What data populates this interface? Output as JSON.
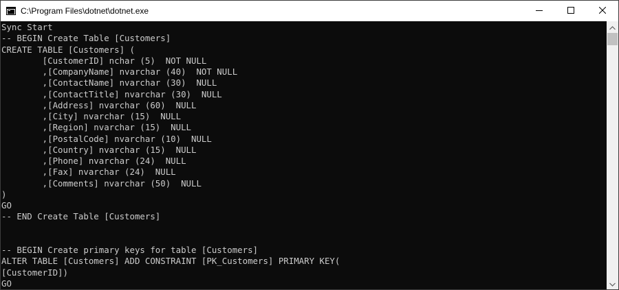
{
  "window": {
    "title": "C:\\Program Files\\dotnet\\dotnet.exe"
  },
  "icons": {
    "app": "console-app-icon",
    "minimize": "minimize-icon",
    "maximize": "maximize-icon",
    "close": "close-icon",
    "scroll_up": "chevron-up-icon",
    "scroll_down": "chevron-down-icon"
  },
  "colors": {
    "console_background": "#0c0c0c",
    "console_text": "#cccccc",
    "titlebar": "#ffffff",
    "scrollbar_track": "#f0f0f0",
    "scrollbar_thumb": "#c1c1c1"
  },
  "console": {
    "lines": [
      "Sync Start",
      "-- BEGIN Create Table [Customers]",
      "CREATE TABLE [Customers] (",
      "        [CustomerID] nchar (5)  NOT NULL",
      "        ,[CompanyName] nvarchar (40)  NOT NULL",
      "        ,[ContactName] nvarchar (30)  NULL",
      "        ,[ContactTitle] nvarchar (30)  NULL",
      "        ,[Address] nvarchar (60)  NULL",
      "        ,[City] nvarchar (15)  NULL",
      "        ,[Region] nvarchar (15)  NULL",
      "        ,[PostalCode] nvarchar (10)  NULL",
      "        ,[Country] nvarchar (15)  NULL",
      "        ,[Phone] nvarchar (24)  NULL",
      "        ,[Fax] nvarchar (24)  NULL",
      "        ,[Comments] nvarchar (50)  NULL",
      ")",
      "GO",
      "-- END Create Table [Customers]",
      "",
      "",
      "-- BEGIN Create primary keys for table [Customers]",
      "ALTER TABLE [Customers] ADD CONSTRAINT [PK_Customers] PRIMARY KEY(",
      "[CustomerID])",
      "GO"
    ]
  },
  "scrollbar": {
    "position": 0
  }
}
